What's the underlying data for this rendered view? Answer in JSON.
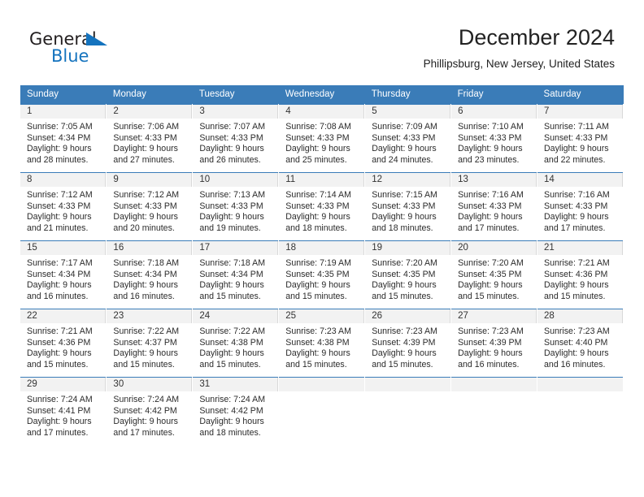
{
  "brand": {
    "name_part1": "General",
    "name_part2": "Blue",
    "triangle_icon": "blue-triangle-logo-mark",
    "colors": {
      "dark": "#231f20",
      "blue": "#1473be"
    }
  },
  "header": {
    "title": "December 2024",
    "subtitle": "Phillipsburg, New Jersey, United States"
  },
  "theme": {
    "header_blue": "#3a7cb8",
    "daynum_bg": "#f2f2f2",
    "text": "#222222"
  },
  "weekday_headers": [
    "Sunday",
    "Monday",
    "Tuesday",
    "Wednesday",
    "Thursday",
    "Friday",
    "Saturday"
  ],
  "weeks": [
    [
      {
        "day": "1",
        "sunrise": "Sunrise: 7:05 AM",
        "sunset": "Sunset: 4:34 PM",
        "daylight1": "Daylight: 9 hours",
        "daylight2": "and 28 minutes."
      },
      {
        "day": "2",
        "sunrise": "Sunrise: 7:06 AM",
        "sunset": "Sunset: 4:33 PM",
        "daylight1": "Daylight: 9 hours",
        "daylight2": "and 27 minutes."
      },
      {
        "day": "3",
        "sunrise": "Sunrise: 7:07 AM",
        "sunset": "Sunset: 4:33 PM",
        "daylight1": "Daylight: 9 hours",
        "daylight2": "and 26 minutes."
      },
      {
        "day": "4",
        "sunrise": "Sunrise: 7:08 AM",
        "sunset": "Sunset: 4:33 PM",
        "daylight1": "Daylight: 9 hours",
        "daylight2": "and 25 minutes."
      },
      {
        "day": "5",
        "sunrise": "Sunrise: 7:09 AM",
        "sunset": "Sunset: 4:33 PM",
        "daylight1": "Daylight: 9 hours",
        "daylight2": "and 24 minutes."
      },
      {
        "day": "6",
        "sunrise": "Sunrise: 7:10 AM",
        "sunset": "Sunset: 4:33 PM",
        "daylight1": "Daylight: 9 hours",
        "daylight2": "and 23 minutes."
      },
      {
        "day": "7",
        "sunrise": "Sunrise: 7:11 AM",
        "sunset": "Sunset: 4:33 PM",
        "daylight1": "Daylight: 9 hours",
        "daylight2": "and 22 minutes."
      }
    ],
    [
      {
        "day": "8",
        "sunrise": "Sunrise: 7:12 AM",
        "sunset": "Sunset: 4:33 PM",
        "daylight1": "Daylight: 9 hours",
        "daylight2": "and 21 minutes."
      },
      {
        "day": "9",
        "sunrise": "Sunrise: 7:12 AM",
        "sunset": "Sunset: 4:33 PM",
        "daylight1": "Daylight: 9 hours",
        "daylight2": "and 20 minutes."
      },
      {
        "day": "10",
        "sunrise": "Sunrise: 7:13 AM",
        "sunset": "Sunset: 4:33 PM",
        "daylight1": "Daylight: 9 hours",
        "daylight2": "and 19 minutes."
      },
      {
        "day": "11",
        "sunrise": "Sunrise: 7:14 AM",
        "sunset": "Sunset: 4:33 PM",
        "daylight1": "Daylight: 9 hours",
        "daylight2": "and 18 minutes."
      },
      {
        "day": "12",
        "sunrise": "Sunrise: 7:15 AM",
        "sunset": "Sunset: 4:33 PM",
        "daylight1": "Daylight: 9 hours",
        "daylight2": "and 18 minutes."
      },
      {
        "day": "13",
        "sunrise": "Sunrise: 7:16 AM",
        "sunset": "Sunset: 4:33 PM",
        "daylight1": "Daylight: 9 hours",
        "daylight2": "and 17 minutes."
      },
      {
        "day": "14",
        "sunrise": "Sunrise: 7:16 AM",
        "sunset": "Sunset: 4:33 PM",
        "daylight1": "Daylight: 9 hours",
        "daylight2": "and 17 minutes."
      }
    ],
    [
      {
        "day": "15",
        "sunrise": "Sunrise: 7:17 AM",
        "sunset": "Sunset: 4:34 PM",
        "daylight1": "Daylight: 9 hours",
        "daylight2": "and 16 minutes."
      },
      {
        "day": "16",
        "sunrise": "Sunrise: 7:18 AM",
        "sunset": "Sunset: 4:34 PM",
        "daylight1": "Daylight: 9 hours",
        "daylight2": "and 16 minutes."
      },
      {
        "day": "17",
        "sunrise": "Sunrise: 7:18 AM",
        "sunset": "Sunset: 4:34 PM",
        "daylight1": "Daylight: 9 hours",
        "daylight2": "and 15 minutes."
      },
      {
        "day": "18",
        "sunrise": "Sunrise: 7:19 AM",
        "sunset": "Sunset: 4:35 PM",
        "daylight1": "Daylight: 9 hours",
        "daylight2": "and 15 minutes."
      },
      {
        "day": "19",
        "sunrise": "Sunrise: 7:20 AM",
        "sunset": "Sunset: 4:35 PM",
        "daylight1": "Daylight: 9 hours",
        "daylight2": "and 15 minutes."
      },
      {
        "day": "20",
        "sunrise": "Sunrise: 7:20 AM",
        "sunset": "Sunset: 4:35 PM",
        "daylight1": "Daylight: 9 hours",
        "daylight2": "and 15 minutes."
      },
      {
        "day": "21",
        "sunrise": "Sunrise: 7:21 AM",
        "sunset": "Sunset: 4:36 PM",
        "daylight1": "Daylight: 9 hours",
        "daylight2": "and 15 minutes."
      }
    ],
    [
      {
        "day": "22",
        "sunrise": "Sunrise: 7:21 AM",
        "sunset": "Sunset: 4:36 PM",
        "daylight1": "Daylight: 9 hours",
        "daylight2": "and 15 minutes."
      },
      {
        "day": "23",
        "sunrise": "Sunrise: 7:22 AM",
        "sunset": "Sunset: 4:37 PM",
        "daylight1": "Daylight: 9 hours",
        "daylight2": "and 15 minutes."
      },
      {
        "day": "24",
        "sunrise": "Sunrise: 7:22 AM",
        "sunset": "Sunset: 4:38 PM",
        "daylight1": "Daylight: 9 hours",
        "daylight2": "and 15 minutes."
      },
      {
        "day": "25",
        "sunrise": "Sunrise: 7:23 AM",
        "sunset": "Sunset: 4:38 PM",
        "daylight1": "Daylight: 9 hours",
        "daylight2": "and 15 minutes."
      },
      {
        "day": "26",
        "sunrise": "Sunrise: 7:23 AM",
        "sunset": "Sunset: 4:39 PM",
        "daylight1": "Daylight: 9 hours",
        "daylight2": "and 15 minutes."
      },
      {
        "day": "27",
        "sunrise": "Sunrise: 7:23 AM",
        "sunset": "Sunset: 4:39 PM",
        "daylight1": "Daylight: 9 hours",
        "daylight2": "and 16 minutes."
      },
      {
        "day": "28",
        "sunrise": "Sunrise: 7:23 AM",
        "sunset": "Sunset: 4:40 PM",
        "daylight1": "Daylight: 9 hours",
        "daylight2": "and 16 minutes."
      }
    ],
    [
      {
        "day": "29",
        "sunrise": "Sunrise: 7:24 AM",
        "sunset": "Sunset: 4:41 PM",
        "daylight1": "Daylight: 9 hours",
        "daylight2": "and 17 minutes."
      },
      {
        "day": "30",
        "sunrise": "Sunrise: 7:24 AM",
        "sunset": "Sunset: 4:42 PM",
        "daylight1": "Daylight: 9 hours",
        "daylight2": "and 17 minutes."
      },
      {
        "day": "31",
        "sunrise": "Sunrise: 7:24 AM",
        "sunset": "Sunset: 4:42 PM",
        "daylight1": "Daylight: 9 hours",
        "daylight2": "and 18 minutes."
      },
      {
        "day": "",
        "sunrise": "",
        "sunset": "",
        "daylight1": "",
        "daylight2": ""
      },
      {
        "day": "",
        "sunrise": "",
        "sunset": "",
        "daylight1": "",
        "daylight2": ""
      },
      {
        "day": "",
        "sunrise": "",
        "sunset": "",
        "daylight1": "",
        "daylight2": ""
      },
      {
        "day": "",
        "sunrise": "",
        "sunset": "",
        "daylight1": "",
        "daylight2": ""
      }
    ]
  ]
}
